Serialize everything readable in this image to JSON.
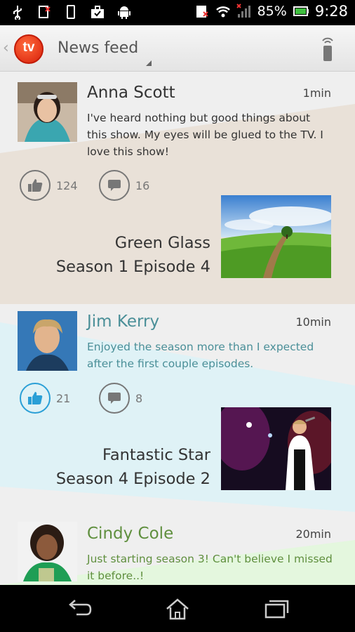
{
  "status_bar": {
    "battery": "85%",
    "time": "9:28",
    "left_icons": [
      "usb-icon",
      "sim-alert-icon",
      "phone-icon",
      "briefcase-icon",
      "android-icon"
    ],
    "right_icons": [
      "sim-icon",
      "wifi-icon",
      "signal-icon",
      "battery-icon"
    ]
  },
  "action_bar": {
    "logo_text": "tv",
    "title": "News feed"
  },
  "posts": [
    {
      "name": "Anna Scott",
      "time": "1min",
      "text": "I've heard nothing but good things about this show. My eyes will be glued to the TV. I love this show!",
      "likes": "124",
      "comments": "16",
      "show_title": "Green Glass",
      "show_episode": "Season 1 Episode 4",
      "liked": false,
      "name_color": "#333333",
      "text_color": "#333333",
      "bg_color": "#e9e1d8"
    },
    {
      "name": "Jim Kerry",
      "time": "10min",
      "text": "Enjoyed the season more than I expected after the first couple episodes.",
      "likes": "21",
      "comments": "8",
      "show_title": "Fantastic Star",
      "show_episode": "Season 4 Episode 2",
      "liked": true,
      "name_color": "#4a8f98",
      "text_color": "#4a8f98",
      "bg_color": "#dff2f6"
    },
    {
      "name": "Cindy Cole",
      "time": "20min",
      "text": "Just starting season 3! Can't believe I missed it before..!",
      "name_color": "#5f8f3e",
      "text_color": "#5f8f3e",
      "bg_color": "#e4f7de"
    }
  ],
  "colors": {
    "like_active": "#2a9fd6",
    "brand": "#e2300f"
  }
}
